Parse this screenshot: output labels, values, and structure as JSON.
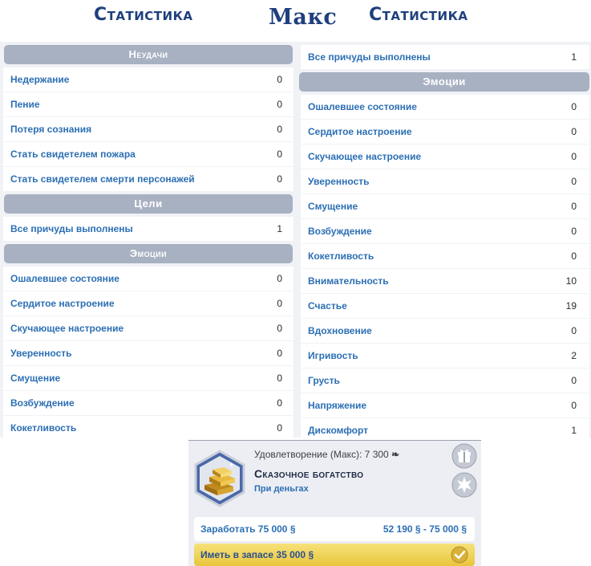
{
  "header": {
    "left_title": "Статистика",
    "center_name": "Макс",
    "right_title": "Статистика"
  },
  "left_panel": {
    "failures_title": "Неудачи",
    "failures": [
      {
        "label": "Недержание",
        "value": "0"
      },
      {
        "label": "Пение",
        "value": "0"
      },
      {
        "label": "Потеря сознания",
        "value": "0"
      },
      {
        "label": "Стать свидетелем пожара",
        "value": "0"
      },
      {
        "label": "Стать свидетелем смерти персонажей",
        "value": "0"
      }
    ],
    "goals_title": "Цели",
    "goals": [
      {
        "label": "Все причуды выполнены",
        "value": "1"
      }
    ],
    "emotions_title": "Эмоции",
    "emotions": [
      {
        "label": "Ошалевшее состояние",
        "value": "0"
      },
      {
        "label": "Сердитое настроение",
        "value": "0"
      },
      {
        "label": "Скучающее настроение",
        "value": "0"
      },
      {
        "label": "Уверенность",
        "value": "0"
      },
      {
        "label": "Смущение",
        "value": "0"
      },
      {
        "label": "Возбуждение",
        "value": "0"
      },
      {
        "label": "Кокетливость",
        "value": "0"
      }
    ]
  },
  "right_panel": {
    "top_row": {
      "label": "Все причуды выполнены",
      "value": "1"
    },
    "emotions_title": "Эмоции",
    "emotions": [
      {
        "label": "Ошалевшее состояние",
        "value": "0"
      },
      {
        "label": "Сердитое настроение",
        "value": "0"
      },
      {
        "label": "Скучающее настроение",
        "value": "0"
      },
      {
        "label": "Уверенность",
        "value": "0"
      },
      {
        "label": "Смущение",
        "value": "0"
      },
      {
        "label": "Возбуждение",
        "value": "0"
      },
      {
        "label": "Кокетливость",
        "value": "0"
      },
      {
        "label": "Внимательность",
        "value": "10"
      },
      {
        "label": "Счастье",
        "value": "19"
      },
      {
        "label": "Вдохновение",
        "value": "0"
      },
      {
        "label": "Игривость",
        "value": "2"
      },
      {
        "label": "Грусть",
        "value": "0"
      },
      {
        "label": "Напряжение",
        "value": "0"
      },
      {
        "label": "Дискомфорт",
        "value": "1"
      }
    ]
  },
  "aspiration_card": {
    "satisfaction": "Удовлетворение (Макс): 7 300",
    "satisfaction_icon": "satisfaction-points-icon",
    "name": "Сказочное богатство",
    "subtitle": "При деньгах",
    "goal1_label": "Заработать 75 000",
    "goal1_progress_current": "52 190",
    "goal1_progress_sep": " - ",
    "goal1_progress_target": "75 000",
    "goal2_label": "Иметь в запасе 35 000",
    "currency_symbol": "§",
    "goal2_complete": true,
    "colors": {
      "gold": "#e9c53d",
      "blue": "#2c6fb4",
      "medal_hex": "#4a68a8"
    }
  }
}
